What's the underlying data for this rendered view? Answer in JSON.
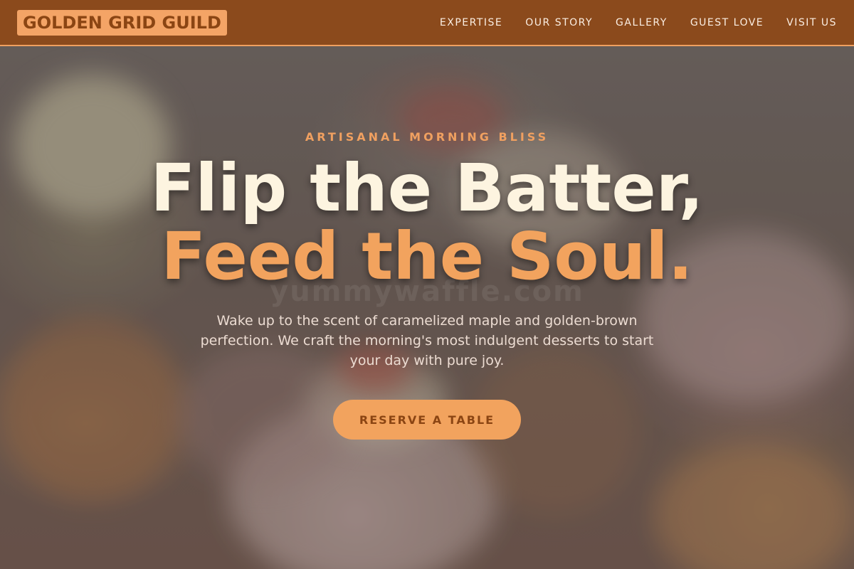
{
  "brand": {
    "name": "GOLDEN GRID GUILD"
  },
  "nav": {
    "items": [
      {
        "label": "EXPERTISE"
      },
      {
        "label": "OUR STORY"
      },
      {
        "label": "GALLERY"
      },
      {
        "label": "GUEST LOVE"
      },
      {
        "label": "VISIT US"
      }
    ]
  },
  "hero": {
    "eyebrow": "ARTISANAL MORNING BLISS",
    "headline_line1": "Flip the Batter,",
    "headline_line2": "Feed the Soul.",
    "watermark": "yummywaffle.com",
    "subtext": "Wake up to the scent of caramelized maple and golden-brown perfection. We craft the morning's most indulgent desserts to start your day with pure joy.",
    "cta_label": "RESERVE A TABLE"
  },
  "colors": {
    "nav_bg": "#8b4a1c",
    "accent": "#f2a35e",
    "headline_light": "#fdf4e0",
    "brand_text": "#8b4513"
  }
}
